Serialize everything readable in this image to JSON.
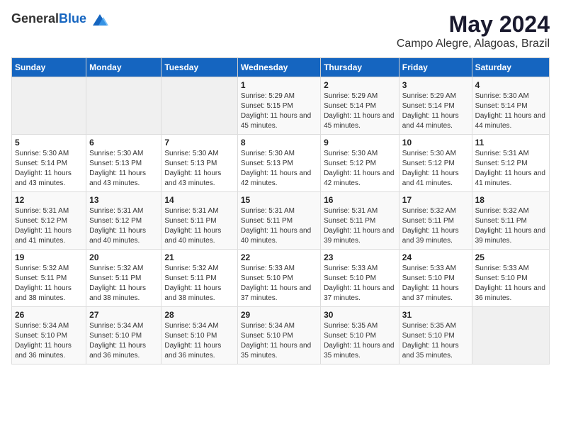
{
  "header": {
    "logo_general": "General",
    "logo_blue": "Blue",
    "title": "May 2024",
    "subtitle": "Campo Alegre, Alagoas, Brazil"
  },
  "weekdays": [
    "Sunday",
    "Monday",
    "Tuesday",
    "Wednesday",
    "Thursday",
    "Friday",
    "Saturday"
  ],
  "weeks": [
    [
      {
        "day": "",
        "sunrise": "",
        "sunset": "",
        "daylight": ""
      },
      {
        "day": "",
        "sunrise": "",
        "sunset": "",
        "daylight": ""
      },
      {
        "day": "",
        "sunrise": "",
        "sunset": "",
        "daylight": ""
      },
      {
        "day": "1",
        "sunrise": "Sunrise: 5:29 AM",
        "sunset": "Sunset: 5:15 PM",
        "daylight": "Daylight: 11 hours and 45 minutes."
      },
      {
        "day": "2",
        "sunrise": "Sunrise: 5:29 AM",
        "sunset": "Sunset: 5:14 PM",
        "daylight": "Daylight: 11 hours and 45 minutes."
      },
      {
        "day": "3",
        "sunrise": "Sunrise: 5:29 AM",
        "sunset": "Sunset: 5:14 PM",
        "daylight": "Daylight: 11 hours and 44 minutes."
      },
      {
        "day": "4",
        "sunrise": "Sunrise: 5:30 AM",
        "sunset": "Sunset: 5:14 PM",
        "daylight": "Daylight: 11 hours and 44 minutes."
      }
    ],
    [
      {
        "day": "5",
        "sunrise": "Sunrise: 5:30 AM",
        "sunset": "Sunset: 5:14 PM",
        "daylight": "Daylight: 11 hours and 43 minutes."
      },
      {
        "day": "6",
        "sunrise": "Sunrise: 5:30 AM",
        "sunset": "Sunset: 5:13 PM",
        "daylight": "Daylight: 11 hours and 43 minutes."
      },
      {
        "day": "7",
        "sunrise": "Sunrise: 5:30 AM",
        "sunset": "Sunset: 5:13 PM",
        "daylight": "Daylight: 11 hours and 43 minutes."
      },
      {
        "day": "8",
        "sunrise": "Sunrise: 5:30 AM",
        "sunset": "Sunset: 5:13 PM",
        "daylight": "Daylight: 11 hours and 42 minutes."
      },
      {
        "day": "9",
        "sunrise": "Sunrise: 5:30 AM",
        "sunset": "Sunset: 5:12 PM",
        "daylight": "Daylight: 11 hours and 42 minutes."
      },
      {
        "day": "10",
        "sunrise": "Sunrise: 5:30 AM",
        "sunset": "Sunset: 5:12 PM",
        "daylight": "Daylight: 11 hours and 41 minutes."
      },
      {
        "day": "11",
        "sunrise": "Sunrise: 5:31 AM",
        "sunset": "Sunset: 5:12 PM",
        "daylight": "Daylight: 11 hours and 41 minutes."
      }
    ],
    [
      {
        "day": "12",
        "sunrise": "Sunrise: 5:31 AM",
        "sunset": "Sunset: 5:12 PM",
        "daylight": "Daylight: 11 hours and 41 minutes."
      },
      {
        "day": "13",
        "sunrise": "Sunrise: 5:31 AM",
        "sunset": "Sunset: 5:12 PM",
        "daylight": "Daylight: 11 hours and 40 minutes."
      },
      {
        "day": "14",
        "sunrise": "Sunrise: 5:31 AM",
        "sunset": "Sunset: 5:11 PM",
        "daylight": "Daylight: 11 hours and 40 minutes."
      },
      {
        "day": "15",
        "sunrise": "Sunrise: 5:31 AM",
        "sunset": "Sunset: 5:11 PM",
        "daylight": "Daylight: 11 hours and 40 minutes."
      },
      {
        "day": "16",
        "sunrise": "Sunrise: 5:31 AM",
        "sunset": "Sunset: 5:11 PM",
        "daylight": "Daylight: 11 hours and 39 minutes."
      },
      {
        "day": "17",
        "sunrise": "Sunrise: 5:32 AM",
        "sunset": "Sunset: 5:11 PM",
        "daylight": "Daylight: 11 hours and 39 minutes."
      },
      {
        "day": "18",
        "sunrise": "Sunrise: 5:32 AM",
        "sunset": "Sunset: 5:11 PM",
        "daylight": "Daylight: 11 hours and 39 minutes."
      }
    ],
    [
      {
        "day": "19",
        "sunrise": "Sunrise: 5:32 AM",
        "sunset": "Sunset: 5:11 PM",
        "daylight": "Daylight: 11 hours and 38 minutes."
      },
      {
        "day": "20",
        "sunrise": "Sunrise: 5:32 AM",
        "sunset": "Sunset: 5:11 PM",
        "daylight": "Daylight: 11 hours and 38 minutes."
      },
      {
        "day": "21",
        "sunrise": "Sunrise: 5:32 AM",
        "sunset": "Sunset: 5:11 PM",
        "daylight": "Daylight: 11 hours and 38 minutes."
      },
      {
        "day": "22",
        "sunrise": "Sunrise: 5:33 AM",
        "sunset": "Sunset: 5:10 PM",
        "daylight": "Daylight: 11 hours and 37 minutes."
      },
      {
        "day": "23",
        "sunrise": "Sunrise: 5:33 AM",
        "sunset": "Sunset: 5:10 PM",
        "daylight": "Daylight: 11 hours and 37 minutes."
      },
      {
        "day": "24",
        "sunrise": "Sunrise: 5:33 AM",
        "sunset": "Sunset: 5:10 PM",
        "daylight": "Daylight: 11 hours and 37 minutes."
      },
      {
        "day": "25",
        "sunrise": "Sunrise: 5:33 AM",
        "sunset": "Sunset: 5:10 PM",
        "daylight": "Daylight: 11 hours and 36 minutes."
      }
    ],
    [
      {
        "day": "26",
        "sunrise": "Sunrise: 5:34 AM",
        "sunset": "Sunset: 5:10 PM",
        "daylight": "Daylight: 11 hours and 36 minutes."
      },
      {
        "day": "27",
        "sunrise": "Sunrise: 5:34 AM",
        "sunset": "Sunset: 5:10 PM",
        "daylight": "Daylight: 11 hours and 36 minutes."
      },
      {
        "day": "28",
        "sunrise": "Sunrise: 5:34 AM",
        "sunset": "Sunset: 5:10 PM",
        "daylight": "Daylight: 11 hours and 36 minutes."
      },
      {
        "day": "29",
        "sunrise": "Sunrise: 5:34 AM",
        "sunset": "Sunset: 5:10 PM",
        "daylight": "Daylight: 11 hours and 35 minutes."
      },
      {
        "day": "30",
        "sunrise": "Sunrise: 5:35 AM",
        "sunset": "Sunset: 5:10 PM",
        "daylight": "Daylight: 11 hours and 35 minutes."
      },
      {
        "day": "31",
        "sunrise": "Sunrise: 5:35 AM",
        "sunset": "Sunset: 5:10 PM",
        "daylight": "Daylight: 11 hours and 35 minutes."
      },
      {
        "day": "",
        "sunrise": "",
        "sunset": "",
        "daylight": ""
      }
    ]
  ]
}
